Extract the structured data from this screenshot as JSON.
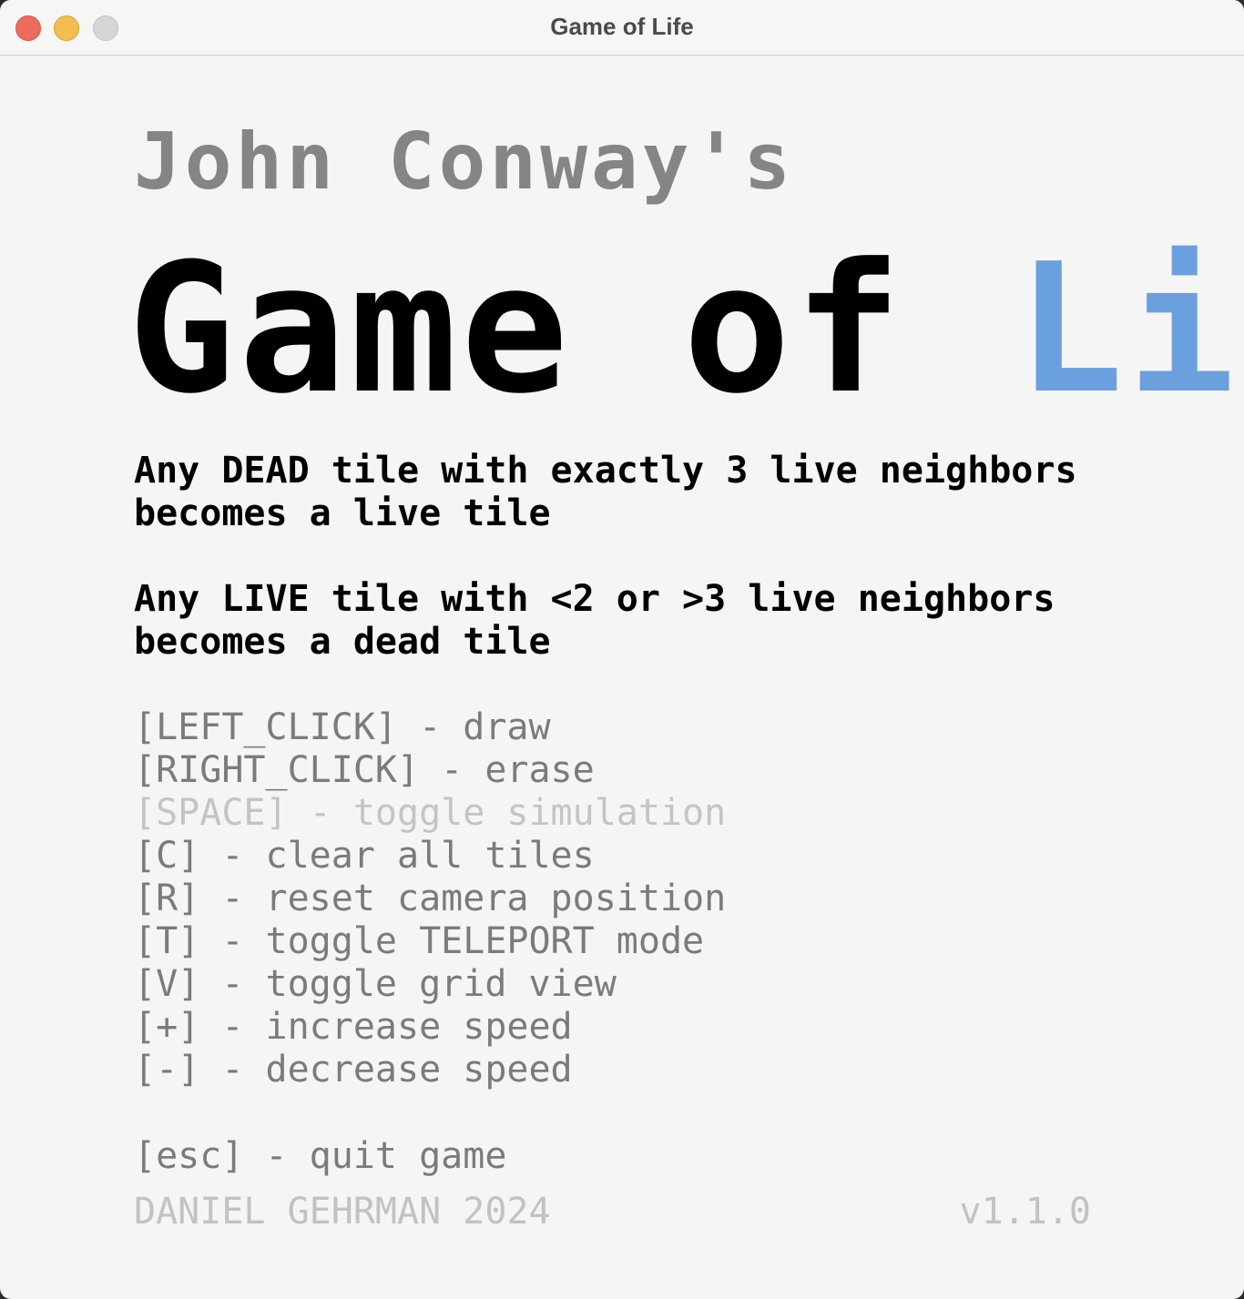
{
  "window": {
    "title": "Game of Life"
  },
  "header": {
    "subtitle": "John Conway's",
    "title_main": "Game of ",
    "title_accent": "Life"
  },
  "rules": [
    {
      "line1": "Any DEAD tile with exactly 3 live neighbors",
      "line2": "becomes a live tile"
    },
    {
      "line1": "Any LIVE tile with <2 or >3 live neighbors",
      "line2": "becomes a dead tile"
    }
  ],
  "controls": [
    {
      "text": "[LEFT_CLICK]  -  draw",
      "dimmed": false
    },
    {
      "text": "[RIGHT_CLICK]  -  erase",
      "dimmed": false
    },
    {
      "text": "[SPACE]  -  toggle simulation",
      "dimmed": true
    },
    {
      "text": "[C]  -  clear all tiles",
      "dimmed": false
    },
    {
      "text": "[R]  -  reset camera position",
      "dimmed": false
    },
    {
      "text": "[T]  -  toggle TELEPORT mode",
      "dimmed": false
    },
    {
      "text": "[V]  -  toggle grid view",
      "dimmed": false
    },
    {
      "text": "[+]  -  increase speed",
      "dimmed": false
    },
    {
      "text": "[-]  -  decrease speed",
      "dimmed": false
    }
  ],
  "quit": "[esc]  -  quit game",
  "footer": {
    "credit": "DANIEL GEHRMAN 2024",
    "version": "v1.1.0"
  },
  "colors": {
    "accent": "#6aa0dd",
    "text_primary": "#000000",
    "text_secondary": "#7b7b7b",
    "text_dim": "#c4c4c4",
    "background": "#f5f5f5"
  }
}
